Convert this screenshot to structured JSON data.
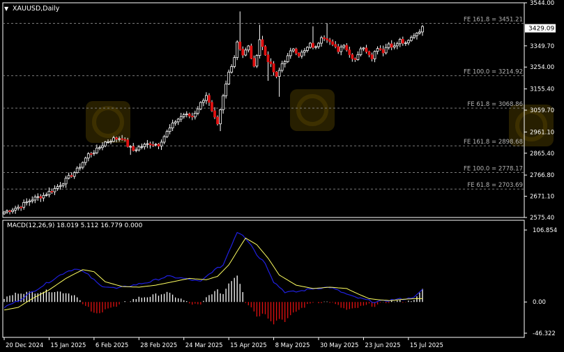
{
  "window": {
    "symbol_title": "XAUUSD,Daily",
    "menu_icon": "triangle-down-icon"
  },
  "colors": {
    "background": "#000000",
    "frame": "#ffffff",
    "grid": "#5a5a5a",
    "bull_body": "#000000",
    "bull_outline": "#ffffff",
    "bear_body": "#e01010",
    "wick": "#ffffff",
    "fib_line": "#7a7a7a",
    "fib_label": "#b4b4b4",
    "text": "#ffffff",
    "macd_line": "#2020e0",
    "signal_line": "#ffff60",
    "hist_pos": "#ffffff",
    "hist_neg": "#e01010",
    "price_tag_bg": "#ffffff",
    "price_tag_text": "#000000",
    "watermark": "#2b2200"
  },
  "price_axis": {
    "min": 2575.4,
    "max": 3544.0,
    "ticks": [
      "3544.00",
      "3349.70",
      "3254.00",
      "3155.40",
      "3059.70",
      "2961.10",
      "2865.40",
      "2766.80",
      "2671.10",
      "2575.40"
    ],
    "tick_values": [
      3544.0,
      3349.7,
      3254.0,
      3155.4,
      3059.7,
      2961.1,
      2865.4,
      2766.8,
      2671.1,
      2575.4
    ],
    "current_price_label": "3429.09",
    "current_price": 3429.09
  },
  "fib_levels": [
    {
      "label": "FE 161.8 = 3451.21",
      "value": 3451.21
    },
    {
      "label": "FE 100.0 = 3214.92",
      "value": 3214.92
    },
    {
      "label": "FE 61.8 = 3068.86",
      "value": 3068.86
    },
    {
      "label": "FE 161.8 = 2898.68",
      "value": 2898.68
    },
    {
      "label": "FE 100.0 = 2778.17",
      "value": 2778.17
    },
    {
      "label": "FE 61.8 = 2703.69",
      "value": 2703.69
    }
  ],
  "macd_panel": {
    "header": "MACD(12,26,9) 18.019 5.112 16.779 0.000",
    "axis_ticks": [
      "106.854",
      "0.00",
      "-46.322"
    ],
    "max": 106.854,
    "min": -46.322
  },
  "time_axis": {
    "labels": [
      "20 Dec 2024",
      "15 Jan 2025",
      "6 Feb 2025",
      "28 Feb 2025",
      "24 Mar 2025",
      "15 Apr 2025",
      "8 May 2025",
      "30 May 2025",
      "23 Jun 2025",
      "15 Jul 2025"
    ],
    "label_bars": [
      0,
      16,
      32,
      48,
      64,
      80,
      96,
      112,
      128,
      144
    ]
  },
  "chart_data": {
    "type": "candlestick",
    "title": "XAUUSD,Daily",
    "bar_count": 150,
    "keypoints": [
      [
        0,
        2600
      ],
      [
        5,
        2622
      ],
      [
        10,
        2658
      ],
      [
        14,
        2675
      ],
      [
        18,
        2705
      ],
      [
        22,
        2745
      ],
      [
        26,
        2790
      ],
      [
        30,
        2860
      ],
      [
        33,
        2880
      ],
      [
        36,
        2915
      ],
      [
        39,
        2930
      ],
      [
        42,
        2935
      ],
      [
        44,
        2900
      ],
      [
        46,
        2878
      ],
      [
        48,
        2892
      ],
      [
        52,
        2910
      ],
      [
        55,
        2905
      ],
      [
        58,
        2960
      ],
      [
        61,
        3010
      ],
      [
        64,
        3040
      ],
      [
        67,
        3030
      ],
      [
        70,
        3090
      ],
      [
        72,
        3130
      ],
      [
        74,
        3050
      ],
      [
        76,
        2990
      ],
      [
        78,
        3120
      ],
      [
        80,
        3230
      ],
      [
        82,
        3300
      ],
      [
        83,
        3370
      ],
      [
        85,
        3310
      ],
      [
        87,
        3345
      ],
      [
        89,
        3250
      ],
      [
        91,
        3380
      ],
      [
        93,
        3310
      ],
      [
        95,
        3260
      ],
      [
        97,
        3205
      ],
      [
        99,
        3270
      ],
      [
        101,
        3300
      ],
      [
        103,
        3340
      ],
      [
        105,
        3310
      ],
      [
        107,
        3325
      ],
      [
        109,
        3355
      ],
      [
        111,
        3340
      ],
      [
        113,
        3395
      ],
      [
        115,
        3385
      ],
      [
        117,
        3350
      ],
      [
        119,
        3330
      ],
      [
        121,
        3360
      ],
      [
        123,
        3310
      ],
      [
        125,
        3290
      ],
      [
        127,
        3340
      ],
      [
        129,
        3330
      ],
      [
        131,
        3300
      ],
      [
        133,
        3345
      ],
      [
        135,
        3325
      ],
      [
        137,
        3360
      ],
      [
        139,
        3345
      ],
      [
        141,
        3375
      ],
      [
        143,
        3355
      ],
      [
        146,
        3400
      ],
      [
        149,
        3430
      ]
    ],
    "spikes": [
      [
        84,
        3505
      ],
      [
        91,
        3445
      ],
      [
        110,
        3438
      ],
      [
        115,
        3452
      ]
    ],
    "dips": [
      [
        94,
        3192
      ],
      [
        98,
        3120
      ],
      [
        77,
        2965
      ],
      [
        45,
        2858
      ]
    ],
    "macd_keypoints": [
      [
        0,
        -8
      ],
      [
        5,
        2
      ],
      [
        10,
        15
      ],
      [
        16,
        30
      ],
      [
        22,
        45
      ],
      [
        26,
        50
      ],
      [
        30,
        40
      ],
      [
        34,
        25
      ],
      [
        40,
        20
      ],
      [
        46,
        25
      ],
      [
        52,
        30
      ],
      [
        58,
        38
      ],
      [
        64,
        35
      ],
      [
        70,
        30
      ],
      [
        74,
        45
      ],
      [
        78,
        55
      ],
      [
        81,
        85
      ],
      [
        83,
        104
      ],
      [
        85,
        100
      ],
      [
        88,
        85
      ],
      [
        90,
        70
      ],
      [
        93,
        58
      ],
      [
        96,
        30
      ],
      [
        100,
        15
      ],
      [
        104,
        15
      ],
      [
        110,
        20
      ],
      [
        116,
        22
      ],
      [
        120,
        15
      ],
      [
        124,
        8
      ],
      [
        128,
        4
      ],
      [
        132,
        0
      ],
      [
        136,
        2
      ],
      [
        140,
        4
      ],
      [
        144,
        5
      ],
      [
        147,
        10
      ],
      [
        149,
        18
      ]
    ],
    "signal_keypoints": [
      [
        0,
        -12
      ],
      [
        5,
        -8
      ],
      [
        10,
        5
      ],
      [
        16,
        18
      ],
      [
        22,
        35
      ],
      [
        28,
        48
      ],
      [
        32,
        45
      ],
      [
        36,
        30
      ],
      [
        42,
        23
      ],
      [
        48,
        22
      ],
      [
        54,
        25
      ],
      [
        60,
        30
      ],
      [
        66,
        35
      ],
      [
        72,
        33
      ],
      [
        76,
        38
      ],
      [
        80,
        55
      ],
      [
        84,
        82
      ],
      [
        86,
        95
      ],
      [
        90,
        85
      ],
      [
        94,
        65
      ],
      [
        98,
        40
      ],
      [
        104,
        25
      ],
      [
        110,
        20
      ],
      [
        116,
        22
      ],
      [
        122,
        20
      ],
      [
        126,
        12
      ],
      [
        130,
        5
      ],
      [
        134,
        3
      ],
      [
        138,
        2
      ],
      [
        142,
        4
      ],
      [
        146,
        5
      ],
      [
        149,
        5
      ]
    ]
  }
}
